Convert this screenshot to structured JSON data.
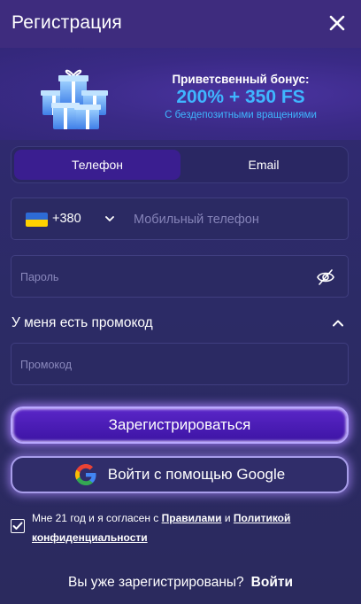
{
  "header": {
    "title": "Регистрация"
  },
  "bonus": {
    "line1": "Приветсвенный бонус:",
    "line2": "200% + 350 FS",
    "line3": "С бездепозитными вращениями"
  },
  "tabs": [
    {
      "label": "Телефон",
      "active": true
    },
    {
      "label": "Email",
      "active": false
    }
  ],
  "phone": {
    "country_code": "+380",
    "placeholder": "Мобильный телефон",
    "flag": "ukraine-flag"
  },
  "password": {
    "placeholder": "Пароль"
  },
  "promo": {
    "toggle_label": "У меня есть промокод",
    "placeholder": "Промокод"
  },
  "buttons": {
    "register": "Зарегистрироваться",
    "google": "Войти с помощью Google"
  },
  "consent": {
    "checked": true,
    "text_before": "Мне 21 год и я согласен с ",
    "rules_link": "Правилами",
    "and": " и ",
    "policy_link": "Политикой конфиденциальности"
  },
  "footer": {
    "question": "Вы уже зарегистрированы?",
    "login_link": "Войти"
  },
  "colors": {
    "accent_blue": "#3fb6ff",
    "primary_purple": "#4a1db8",
    "background": "#2c2b66"
  }
}
